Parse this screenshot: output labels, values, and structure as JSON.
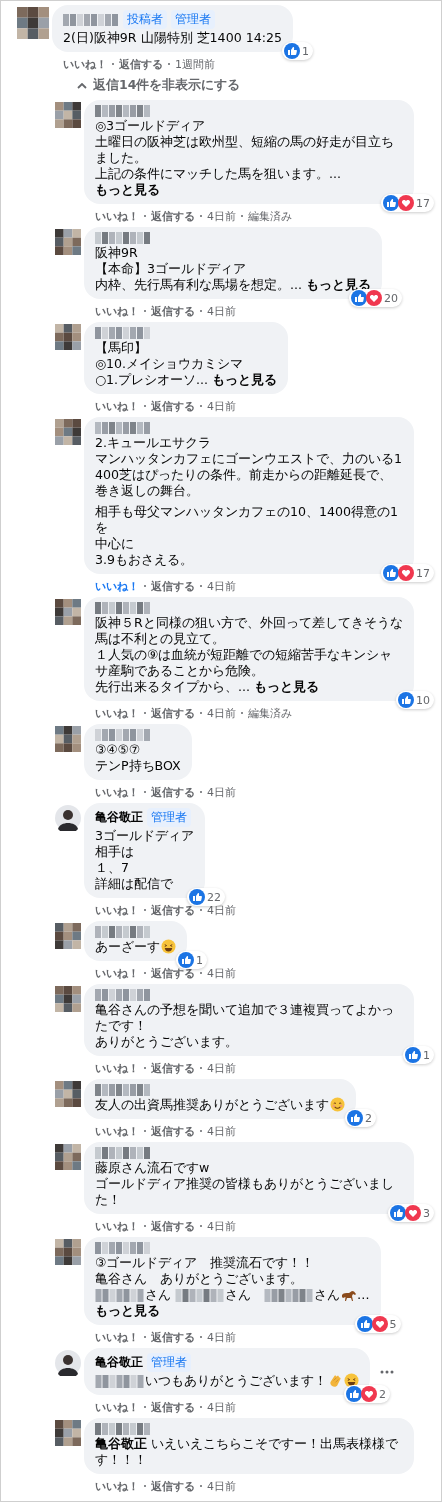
{
  "comment": {
    "author": {
      "redacted": true
    },
    "badges": [
      "投稿者",
      "管理者"
    ],
    "body": [
      [
        "2(日)阪神9R 山陽特別 芝1400 14:25"
      ]
    ],
    "reactions": {
      "like": true,
      "love": false,
      "count": "1"
    },
    "actions": {
      "like": "いいね！",
      "reply": "返信する",
      "time": "1週間前"
    },
    "liked": false
  },
  "hide_replies": "返信14件を非表示にする",
  "replies": [
    {
      "author": {
        "redacted": true
      },
      "body": [
        [
          "◎3ゴールドディア",
          "土曜日の阪神芝は欧州型、短縮の馬の好走が目立ちました。",
          [
            "上記の条件にマッチした馬を狙います。... ",
            {
              "kind": "see_more",
              "text": "もっと見る"
            }
          ]
        ]
      ],
      "reactions": {
        "like": true,
        "love": true,
        "count": "17"
      },
      "actions": {
        "like": "いいね！",
        "reply": "返信する",
        "time": "4日前",
        "edited": "編集済み"
      },
      "liked": false
    },
    {
      "author": {
        "redacted": true
      },
      "body": [
        [
          "阪神9R",
          "【本命】3ゴールドディア",
          [
            "内枠、先行馬有利な馬場を想定。... ",
            {
              "kind": "see_more",
              "text": "もっと見る"
            }
          ]
        ]
      ],
      "reactions": {
        "like": true,
        "love": true,
        "count": "20"
      },
      "actions": {
        "like": "いいね！",
        "reply": "返信する",
        "time": "4日前"
      },
      "liked": false
    },
    {
      "author": {
        "redacted": true
      },
      "body": [
        [
          "【馬印】",
          "◎10.メイショウカミシマ",
          [
            "○1.プレシオーソ... ",
            {
              "kind": "see_more",
              "text": "もっと見る"
            }
          ]
        ]
      ],
      "actions": {
        "like": "いいね！",
        "reply": "返信する",
        "time": "4日前"
      },
      "liked": false
    },
    {
      "author": {
        "redacted": true
      },
      "body": [
        [
          "2.キュールエサクラ",
          "マンハッタンカフェにゴーンウエストで、力のいる1400芝はぴったりの条件。前走からの距離延長で、巻き返しの舞台。"
        ],
        [
          "相手も母父マンハッタンカフェの10、1400得意の1を",
          "中心に",
          "3.9もおさえる。"
        ]
      ],
      "reactions": {
        "like": true,
        "love": true,
        "count": "17"
      },
      "actions": {
        "like": "いいね！",
        "reply": "返信する",
        "time": "4日前"
      },
      "liked": true
    },
    {
      "author": {
        "redacted": true
      },
      "body": [
        [
          "阪神５Rと同様の狙い方で、外回って差してきそうな馬は不利との見立て。",
          "１人気の⑨は血統が短距離での短縮苦手なキンシャサ産駒であることから危険。",
          [
            "先行出来るタイプから、... ",
            {
              "kind": "see_more",
              "text": "もっと見る"
            }
          ]
        ]
      ],
      "reactions": {
        "like": true,
        "love": false,
        "count": "10"
      },
      "actions": {
        "like": "いいね！",
        "reply": "返信する",
        "time": "4日前",
        "edited": "編集済み"
      },
      "liked": false
    },
    {
      "author": {
        "redacted": true
      },
      "body": [
        [
          "③④⑤⑦",
          "テンP持ちBOX"
        ]
      ],
      "actions": {
        "like": "いいね！",
        "reply": "返信する",
        "time": "4日前"
      },
      "liked": false
    },
    {
      "author": {
        "redacted": false,
        "name": "亀谷敬正"
      },
      "badges": [
        "管理者"
      ],
      "body": [
        [
          "3ゴールドディア",
          "相手は",
          "１、7",
          "詳細は配信で"
        ]
      ],
      "reactions": {
        "like": true,
        "love": false,
        "count": "22"
      },
      "actions": {
        "like": "いいね！",
        "reply": "返信する",
        "time": "4日前"
      },
      "liked": false
    },
    {
      "author": {
        "redacted": true
      },
      "body": [
        [
          [
            "あーざーす",
            {
              "kind": "laugh"
            }
          ]
        ]
      ],
      "reactions": {
        "like": true,
        "love": false,
        "count": "1"
      },
      "actions": {
        "like": "いいね！",
        "reply": "返信する",
        "time": "4日前"
      },
      "liked": false
    },
    {
      "author": {
        "redacted": true
      },
      "body": [
        [
          "亀谷さんの予想を聞いて追加で３連複買ってよかったです！",
          "ありがとうございます。"
        ]
      ],
      "reactions": {
        "like": true,
        "love": false,
        "count": "1"
      },
      "actions": {
        "like": "いいね！",
        "reply": "返信する",
        "time": "4日前"
      },
      "liked": false
    },
    {
      "author": {
        "redacted": true
      },
      "body": [
        [
          [
            "友人の出資馬推奨ありがとうございます",
            {
              "kind": "smile"
            }
          ]
        ]
      ],
      "reactions": {
        "like": true,
        "love": false,
        "count": "2"
      },
      "actions": {
        "like": "いいね！",
        "reply": "返信する",
        "time": "4日前"
      },
      "liked": false
    },
    {
      "author": {
        "redacted": true
      },
      "body": [
        [
          "藤原さん流石ですw",
          "ゴールドディア推奨の皆様もありがとうございました！"
        ]
      ],
      "reactions": {
        "like": true,
        "love": true,
        "count": "3"
      },
      "actions": {
        "like": "いいね！",
        "reply": "返信する",
        "time": "4日前"
      },
      "liked": false
    },
    {
      "author": {
        "redacted": true
      },
      "body": [
        [
          "③ゴールドディア　推奨流石です！！",
          "亀谷さん　ありがとうございます。",
          [
            {
              "kind": "mention_redacted"
            },
            "さん ",
            {
              "kind": "mention_redacted"
            },
            "さん　",
            {
              "kind": "mention_redacted"
            },
            "さん",
            {
              "kind": "horse"
            },
            "…"
          ],
          [
            {
              "kind": "see_more",
              "text": "もっと見る"
            }
          ]
        ]
      ],
      "reactions": {
        "like": true,
        "love": true,
        "count": "5"
      },
      "actions": {
        "like": "いいね！",
        "reply": "返信する",
        "time": "4日前"
      },
      "liked": false
    },
    {
      "author": {
        "redacted": false,
        "name": "亀谷敬正"
      },
      "badges": [
        "管理者"
      ],
      "body": [
        [
          [
            {
              "kind": "mention_redacted"
            },
            "いつもありがとうございます！",
            {
              "kind": "clap"
            },
            {
              "kind": "laugh"
            }
          ]
        ]
      ],
      "reactions": {
        "like": true,
        "love": true,
        "count": "2"
      },
      "actions": {
        "like": "いいね！",
        "reply": "返信する",
        "time": "4日前"
      },
      "liked": false,
      "menu": true
    },
    {
      "author": {
        "redacted": true
      },
      "body": [
        [
          [
            {
              "kind": "mention",
              "text": "亀谷敬正"
            },
            " いえいえこちらこそですー！出馬表様様です！！！"
          ]
        ]
      ],
      "actions": {
        "like": "いいね！",
        "reply": "返信する",
        "time": "4日前"
      },
      "liked": false
    }
  ]
}
